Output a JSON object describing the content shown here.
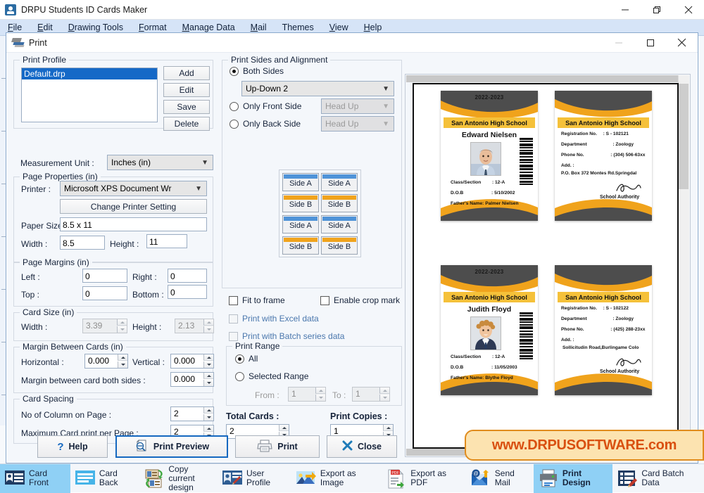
{
  "window": {
    "title": "DRPU Students ID Cards Maker",
    "app_icon": "id-card-icon",
    "minimize": "minimize-icon",
    "maximize": "restore-icon",
    "close": "close-icon"
  },
  "menubar": [
    {
      "label": "File",
      "accel": "F"
    },
    {
      "label": "Edit",
      "accel": "E"
    },
    {
      "label": "Drawing Tools",
      "accel": "D"
    },
    {
      "label": "Format",
      "accel": "F"
    },
    {
      "label": "Manage Data",
      "accel": "M"
    },
    {
      "label": "Mail",
      "accel": "M"
    },
    {
      "label": "Themes",
      "accel": ""
    },
    {
      "label": "View",
      "accel": "V"
    },
    {
      "label": "Help",
      "accel": "H"
    }
  ],
  "dialog": {
    "title": "Print",
    "icon": "printer-icon",
    "minimize": "minimize-icon",
    "maximize": "maximize-icon",
    "close": "close-icon"
  },
  "print_profile": {
    "legend": "Print Profile",
    "selected_item": "Default.drp",
    "buttons": {
      "add": "Add",
      "edit": "Edit",
      "save": "Save",
      "delete": "Delete"
    }
  },
  "measurement": {
    "label": "Measurement Unit :",
    "value": "Inches (in)"
  },
  "page_properties": {
    "legend": "Page Properties (in)",
    "printer_label": "Printer :",
    "printer_value": "Microsoft XPS Document Wr",
    "change_printer_button": "Change Printer Setting",
    "paper_size_label": "Paper Size :",
    "paper_size_value": "8.5 x 11",
    "width_label": "Width :",
    "width_value": "8.5",
    "height_label": "Height :",
    "height_value": "11"
  },
  "page_margins": {
    "legend": "Page Margins (in)",
    "left_label": "Left :",
    "left_value": "0",
    "right_label": "Right :",
    "right_value": "0",
    "top_label": "Top :",
    "top_value": "0",
    "bottom_label": "Bottom :",
    "bottom_value": "0"
  },
  "card_size": {
    "legend": "Card Size (in)",
    "width_label": "Width :",
    "width_value": "3.39",
    "height_label": "Height :",
    "height_value": "2.13"
  },
  "margin_between_cards": {
    "legend": "Margin Between Cards (in)",
    "horizontal_label": "Horizontal :",
    "horizontal_value": "0.000",
    "vertical_label": "Vertical :",
    "vertical_value": "0.000",
    "both_sides_label": "Margin between card both sides :",
    "both_sides_value": "0.000"
  },
  "card_spacing": {
    "legend": "Card Spacing",
    "columns_label": "No of Column on Page :",
    "columns_value": "2",
    "max_label": "Maximum Card print per Page :",
    "max_value": "2"
  },
  "print_sides": {
    "legend": "Print Sides and Alignment",
    "both_sides_label": "Both Sides",
    "both_sides_selected": true,
    "both_sides_value": "Up-Down 2",
    "only_front_label": "Only Front Side",
    "only_front_value": "Head Up",
    "only_back_label": "Only Back Side",
    "only_back_value": "Head Up",
    "grid": [
      {
        "label": "Side A",
        "color": "#4f93d8"
      },
      {
        "label": "Side A",
        "color": "#4f93d8"
      },
      {
        "label": "Side B",
        "color": "#f0a31c"
      },
      {
        "label": "Side B",
        "color": "#f0a31c"
      },
      {
        "label": "Side A",
        "color": "#4f93d8"
      },
      {
        "label": "Side A",
        "color": "#4f93d8"
      },
      {
        "label": "Side B",
        "color": "#f0a31c"
      },
      {
        "label": "Side B",
        "color": "#f0a31c"
      }
    ]
  },
  "options": {
    "fit_to_frame": "Fit to frame",
    "fit_to_frame_checked": false,
    "enable_crop_mark": "Enable crop mark",
    "enable_crop_mark_checked": false,
    "print_excel": "Print with Excel data",
    "print_excel_disabled": true,
    "print_batch": "Print with Batch series data",
    "print_batch_disabled": true
  },
  "print_range": {
    "legend": "Print Range",
    "all_label": "All",
    "all_selected": true,
    "selected_range_label": "Selected Range",
    "from_label": "From :",
    "from_value": "1",
    "to_label": "To :",
    "to_value": "1"
  },
  "totals": {
    "total_cards_label": "Total Cards :",
    "total_cards_value": "2",
    "print_copies_label": "Print Copies :",
    "print_copies_value": "1"
  },
  "action_buttons": {
    "help": "Help",
    "print_preview": "Print Preview",
    "print": "Print",
    "close": "Close"
  },
  "preview": {
    "cards": [
      {
        "side": "front",
        "year": "2022-2023",
        "school": "San Antonio High School",
        "name": "Edward Nielsen",
        "fields": [
          {
            "label": "Class/Section",
            "sep": ":",
            "value": "12-A"
          },
          {
            "label": "D.O.B",
            "sep": ":",
            "value": "5/10/2002"
          }
        ],
        "father": "Father's Name: Palmer Nielsen",
        "photo": "male-student-photo"
      },
      {
        "side": "back",
        "school": "San Antonio High School",
        "fields": [
          {
            "label": "Registration No.",
            "sep": ":",
            "value": "S - 102121"
          },
          {
            "label": "Department",
            "sep": ":",
            "value": "Zoology"
          },
          {
            "label": "Phone No.",
            "sep": ":",
            "value": "(304) 506-63xx"
          }
        ],
        "address_label": "Add.  :",
        "address_value": "P.O. Box 372 Montes Rd.Springdal",
        "authority": "School Authority"
      },
      {
        "side": "front",
        "year": "2022-2023",
        "school": "San Antonio High School",
        "name": "Judith Floyd",
        "fields": [
          {
            "label": "Class/Section",
            "sep": ":",
            "value": "12-A"
          },
          {
            "label": "D.O.B",
            "sep": ":",
            "value": "11/05/2003"
          }
        ],
        "father": "Father's Name: Blythe Floyd",
        "photo": "child-student-photo"
      },
      {
        "side": "back",
        "school": "San Antonio High School",
        "fields": [
          {
            "label": "Registration No.",
            "sep": ":",
            "value": "S - 102122"
          },
          {
            "label": "Department",
            "sep": ":",
            "value": "Zoology"
          },
          {
            "label": "Phone No.",
            "sep": ":",
            "value": "(425) 288-23xx"
          }
        ],
        "address_label": "Add.  :",
        "address_value": "Sollicitudin Road,Burlingame Colo",
        "authority": "School Authority"
      }
    ]
  },
  "taskbar": [
    {
      "label": "Card Front",
      "icon": "card-front-icon",
      "active": true
    },
    {
      "label": "Card Back",
      "icon": "card-back-icon",
      "active": false
    },
    {
      "label": "Copy current design",
      "icon": "copy-design-icon",
      "active": false
    },
    {
      "label": "User Profile",
      "icon": "user-profile-icon",
      "active": false
    },
    {
      "label": "Export as Image",
      "icon": "export-image-icon",
      "active": false
    },
    {
      "label": "Export as PDF",
      "icon": "export-pdf-icon",
      "active": false
    },
    {
      "label": "Send Mail",
      "icon": "send-mail-icon",
      "active": false
    },
    {
      "label": "Print Design",
      "icon": "print-design-icon",
      "active": true
    },
    {
      "label": "Card Batch Data",
      "icon": "card-batch-icon",
      "active": false
    }
  ],
  "watermark": {
    "text": "www.DRPUSOFTWARE.com"
  },
  "colors": {
    "accent_blue": "#1568c0",
    "card_yellow": "#f5c13a",
    "card_dark": "#4d4d4d",
    "watermark_orange": "#d94f10",
    "selection_blue": "#1569c7"
  }
}
